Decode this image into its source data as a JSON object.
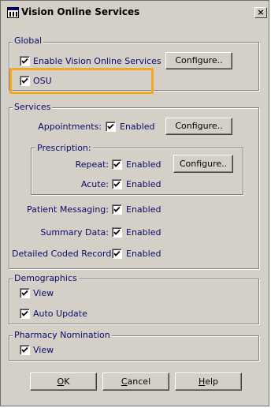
{
  "window": {
    "title": "Vision Online Services",
    "close_label": "×"
  },
  "global": {
    "legend": "Global",
    "enable_vos": {
      "label": "Enable Vision Online Services",
      "checked": true
    },
    "osu": {
      "label": "OSU",
      "checked": true
    },
    "configure_label": "Configure.."
  },
  "services": {
    "legend": "Services",
    "appointments": {
      "label": "Appointments:",
      "enabled_label": "Enabled",
      "checked": true
    },
    "configure_label": "Configure..",
    "prescription": {
      "legend": "Prescription:",
      "repeat": {
        "label": "Repeat:",
        "enabled_label": "Enabled",
        "checked": true
      },
      "acute": {
        "label": "Acute:",
        "enabled_label": "Enabled",
        "checked": true
      },
      "configure_label": "Configure.."
    },
    "patient_messaging": {
      "label": "Patient Messaging:",
      "enabled_label": "Enabled",
      "checked": true
    },
    "summary_data": {
      "label": "Summary Data:",
      "enabled_label": "Enabled",
      "checked": true
    },
    "detailed_coded_record": {
      "label": "Detailed Coded Record:",
      "enabled_label": "Enabled",
      "checked": true
    }
  },
  "demographics": {
    "legend": "Demographics",
    "view": {
      "label": "View",
      "checked": true
    },
    "auto_update": {
      "label": "Auto Update",
      "checked": true
    }
  },
  "pharmacy": {
    "legend": "Pharmacy Nomination",
    "view": {
      "label": "View",
      "checked": true
    }
  },
  "buttons": {
    "ok": {
      "mnemonic": "O",
      "rest": "K"
    },
    "cancel": {
      "mnemonic": "C",
      "rest": "ancel"
    },
    "help": {
      "mnemonic": "H",
      "rest": "elp"
    }
  },
  "colors": {
    "highlight": "#f5a623",
    "label_text": "#0a0a6a",
    "dialog_bg": "#d4d0c8"
  }
}
